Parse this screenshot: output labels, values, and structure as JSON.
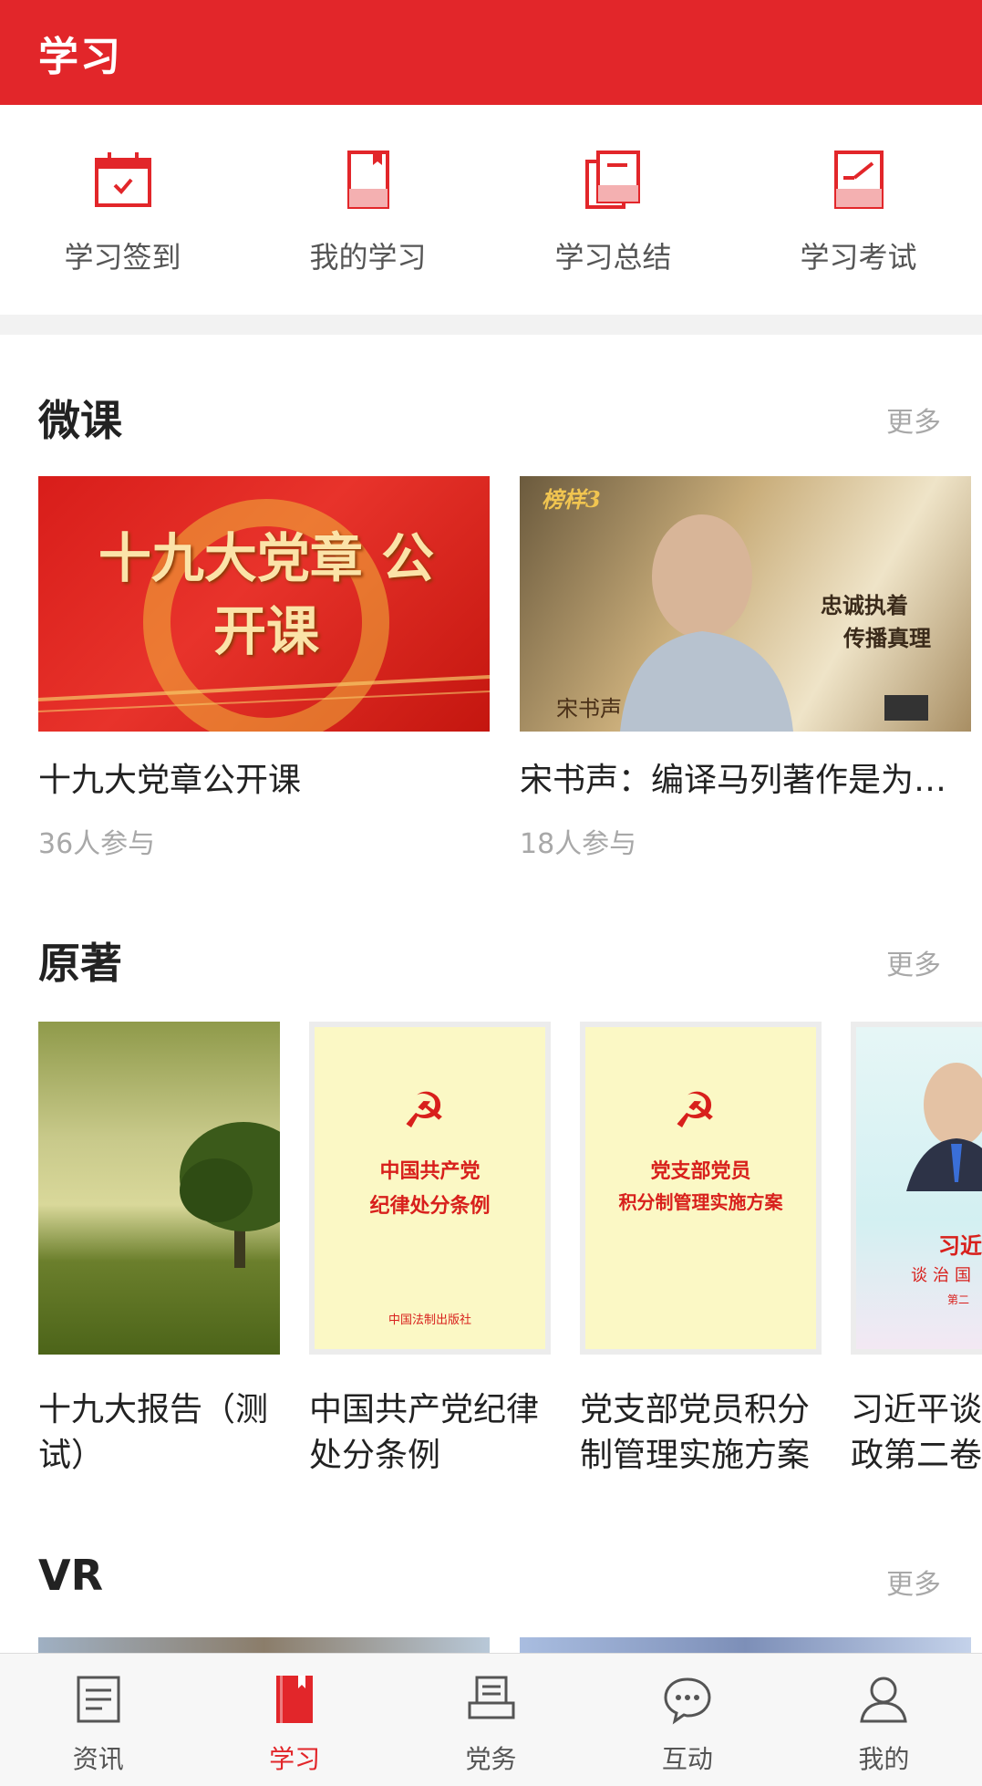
{
  "header": {
    "title": "学习"
  },
  "quick_actions": [
    {
      "label": "学习签到",
      "icon": "calendar-check-icon"
    },
    {
      "label": "我的学习",
      "icon": "bookmark-book-icon"
    },
    {
      "label": "学习总结",
      "icon": "stacked-docs-icon"
    },
    {
      "label": "学习考试",
      "icon": "exam-edit-icon"
    }
  ],
  "sections": {
    "weike": {
      "title": "微课",
      "more": "更多",
      "items": [
        {
          "title": "十九大党章公开课",
          "meta": "36人参与",
          "thumb_text": "十九大党章 公开课"
        },
        {
          "title": "宋书声：编译马列著作是为人民服务",
          "meta": "18人参与",
          "thumb_text": [
            "忠诚执着",
            "传播真理",
            "宋书声",
            "榜样3"
          ]
        }
      ]
    },
    "yuanzhu": {
      "title": "原著",
      "more": "更多",
      "items": [
        {
          "title": "十九大报告（测试）",
          "cover": "tree-landscape"
        },
        {
          "title": "中国共产党纪律处分条例",
          "cover_lines": [
            "中国共产党",
            "纪律处分条例"
          ],
          "publisher": "中国法制出版社"
        },
        {
          "title": "党支部党员积分制管理实施方案",
          "cover_lines": [
            "党支部党员",
            "积分制管理实施方案"
          ]
        },
        {
          "title": "习近平谈治国理政第二卷",
          "cover_lines": [
            "习近",
            "谈治国",
            "第二"
          ]
        }
      ]
    },
    "vr": {
      "title": "VR",
      "more": "更多"
    }
  },
  "tabbar": [
    {
      "label": "资讯",
      "icon": "news-doc-icon",
      "active": false
    },
    {
      "label": "学习",
      "icon": "book-icon",
      "active": true
    },
    {
      "label": "党务",
      "icon": "printer-icon",
      "active": false
    },
    {
      "label": "互动",
      "icon": "chat-bubble-icon",
      "active": false
    },
    {
      "label": "我的",
      "icon": "user-icon",
      "active": false
    }
  ],
  "colors": {
    "brand_red": "#e2262a",
    "muted": "#a8a8a8"
  }
}
